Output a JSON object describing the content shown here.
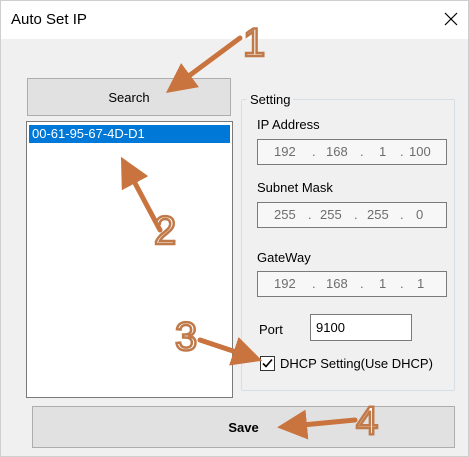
{
  "window": {
    "title": "Auto Set IP"
  },
  "toolbar": {
    "search_label": "Search",
    "save_label": "Save"
  },
  "device_list": {
    "items": [
      "00-61-95-67-4D-D1"
    ]
  },
  "setting": {
    "legend": "Setting",
    "ip_address": {
      "label": "IP Address",
      "octets": [
        "192",
        "168",
        "1",
        "100"
      ]
    },
    "subnet_mask": {
      "label": "Subnet Mask",
      "octets": [
        "255",
        "255",
        "255",
        "0"
      ]
    },
    "gateway": {
      "label": "GateWay",
      "octets": [
        "192",
        "168",
        "1",
        "1"
      ]
    },
    "port": {
      "label": "Port",
      "value": "9100"
    },
    "dhcp": {
      "label": "DHCP Setting(Use DHCP)",
      "checked": true
    }
  },
  "annotations": {
    "markers": [
      "1",
      "2",
      "3",
      "4"
    ],
    "color": "#c9743e"
  },
  "colors": {
    "selection": "#0078d7",
    "window_bg": "#f0f0f0",
    "button_bg": "#e1e1e1"
  }
}
